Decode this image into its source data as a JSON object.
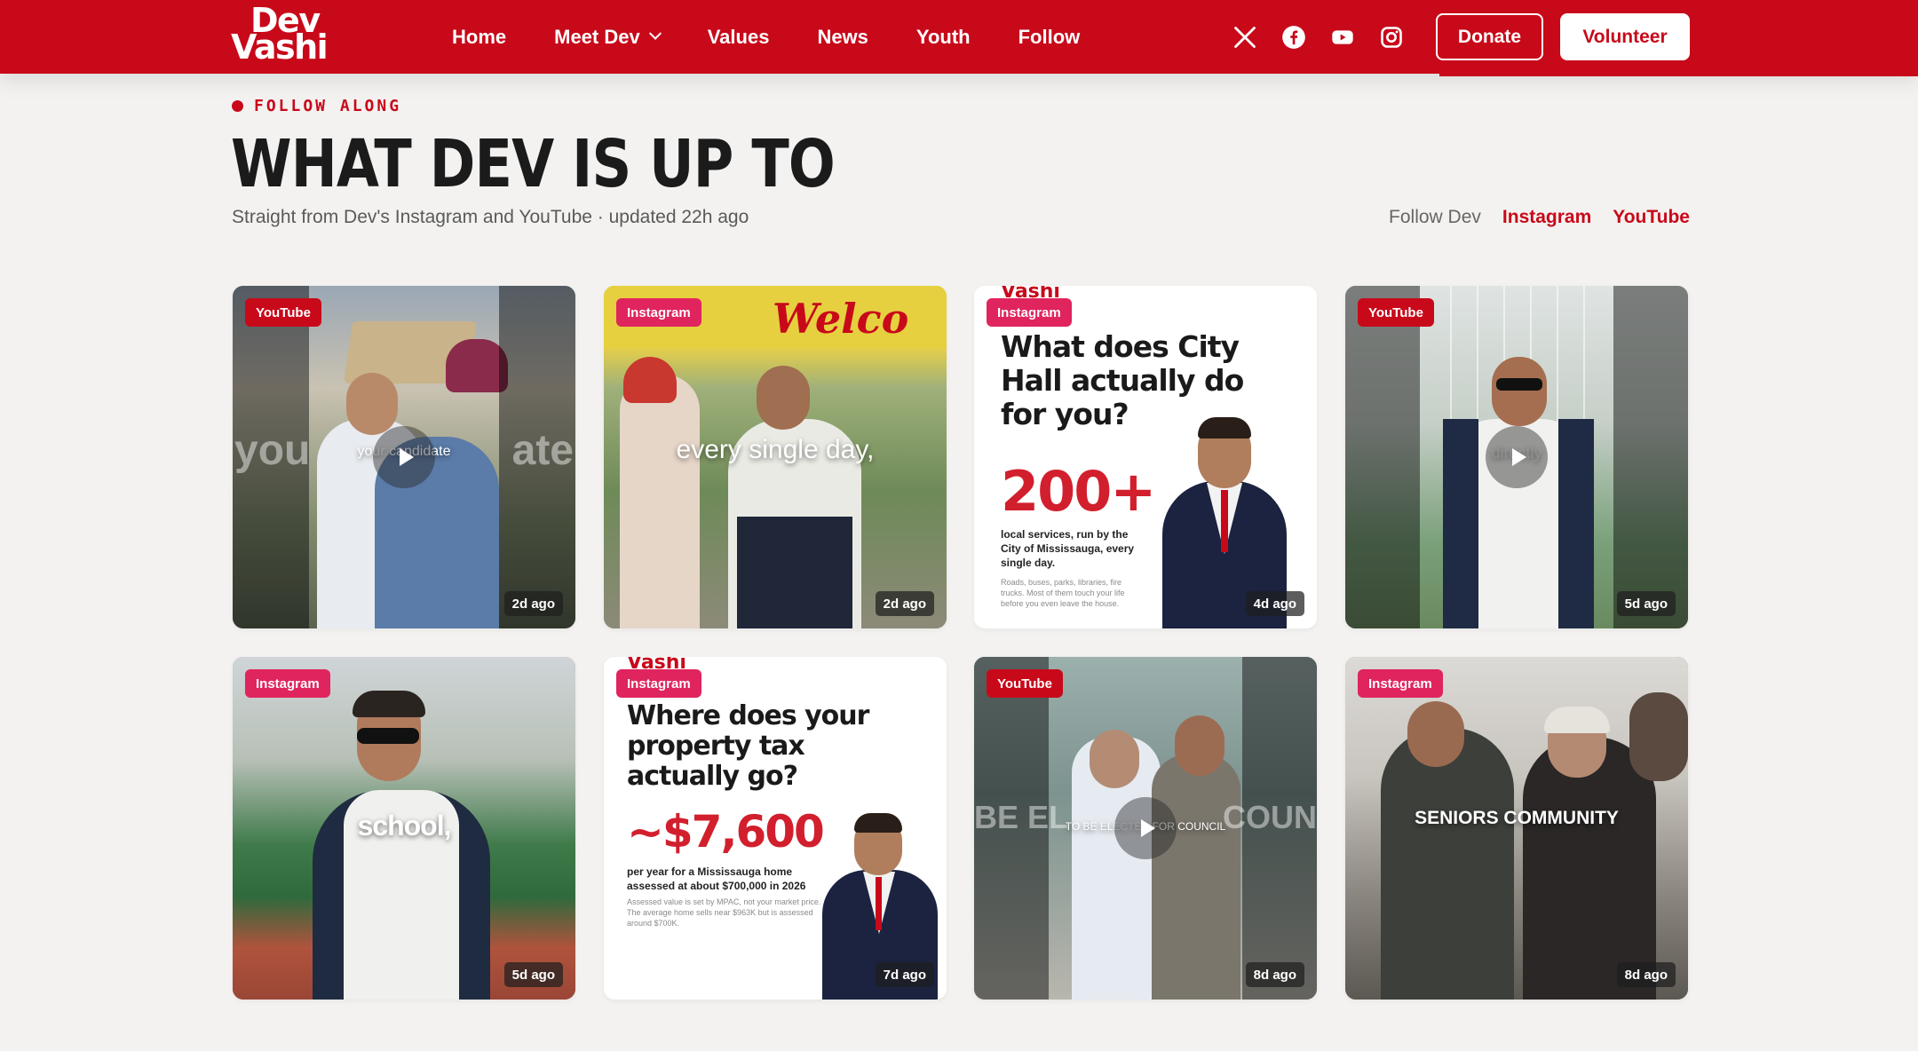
{
  "brand": {
    "logo_line1": "Dev",
    "logo_line2": "Vashi"
  },
  "nav": {
    "items": [
      "Home",
      "Meet Dev",
      "Values",
      "News",
      "Youth",
      "Follow"
    ],
    "donate_label": "Donate",
    "volunteer_label": "Volunteer",
    "social_icons": [
      "x-icon",
      "facebook-icon",
      "youtube-icon",
      "instagram-icon"
    ]
  },
  "section": {
    "eyebrow": "FOLLOW ALONG",
    "title": "WHAT DEV IS UP TO",
    "subtitle": "Straight from Dev's Instagram and YouTube · updated 22h ago",
    "follow_label": "Follow Dev",
    "follow_instagram": "Instagram",
    "follow_youtube": "YouTube"
  },
  "colors": {
    "brand_red": "#c8091a",
    "instagram_pink": "#e0245e",
    "page_bg": "#f3f2f0"
  },
  "posts": [
    {
      "platform": "YouTube",
      "age": "2d ago",
      "caption": "your candidate",
      "side_left": "you",
      "side_right": "ate",
      "video": true
    },
    {
      "platform": "Instagram",
      "age": "2d ago",
      "caption": "every single day,",
      "video": false
    },
    {
      "platform": "Instagram",
      "age": "4d ago",
      "brand": "Vashi",
      "title": "What does City Hall actually do for you?",
      "big": "200+",
      "body": "local services, run by the City of Mississauga, every single day.",
      "fine": "Roads, buses, parks, libraries, fire trucks. Most of them touch your life before you even leave the house."
    },
    {
      "platform": "YouTube",
      "age": "5d ago",
      "caption": "directly",
      "video": true
    },
    {
      "platform": "Instagram",
      "age": "5d ago",
      "caption": "school,",
      "video": false
    },
    {
      "platform": "Instagram",
      "age": "7d ago",
      "brand": "Vashi",
      "title": "Where does your property tax actually go?",
      "big": "~$7,600",
      "body": "per year for a Mississauga home assessed at about $700,000 in 2026",
      "fine": "Assessed value is set by MPAC, not your market price. The average home sells near $963K but is assessed around $700K."
    },
    {
      "platform": "YouTube",
      "age": "8d ago",
      "caption": "TO BE ELECTED FOR COUNCIL",
      "side_left": "BE EL",
      "side_right": "COUN",
      "video": true
    },
    {
      "platform": "Instagram",
      "age": "8d ago",
      "caption": "SENIORS COMMUNITY",
      "video": false
    }
  ]
}
